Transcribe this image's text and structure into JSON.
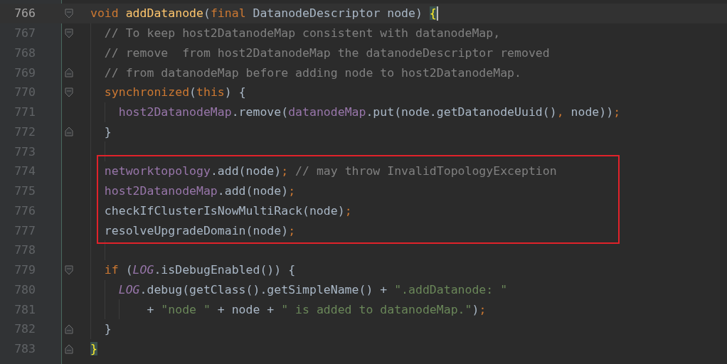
{
  "editor": {
    "lines": [
      {
        "number": "766",
        "current": true,
        "fold_open": true,
        "fold_close": false,
        "boxed": false,
        "caret": true,
        "tokens": [
          {
            "text": "void ",
            "kind": "kw"
          },
          {
            "text": "addDatanode",
            "kind": "fn"
          },
          {
            "text": "(",
            "kind": "plain"
          },
          {
            "text": "final ",
            "kind": "kw"
          },
          {
            "text": "DatanodeDescriptor node) ",
            "kind": "plain"
          },
          {
            "text": "{",
            "kind": "brace"
          }
        ],
        "children": [
          {
            "number": "767",
            "current": false,
            "fold_open": true,
            "fold_close": false,
            "boxed": false,
            "caret": false,
            "tokens": [
              {
                "text": "// To keep host2DatanodeMap consistent with datanodeMap,",
                "kind": "comment"
              }
            ]
          },
          {
            "number": "768",
            "current": false,
            "fold_open": false,
            "fold_close": false,
            "boxed": false,
            "caret": false,
            "tokens": [
              {
                "text": "// remove  from host2DatanodeMap the datanodeDescriptor removed",
                "kind": "comment"
              }
            ]
          },
          {
            "number": "769",
            "current": false,
            "fold_open": false,
            "fold_close": true,
            "boxed": false,
            "caret": false,
            "tokens": [
              {
                "text": "// from datanodeMap before adding node to host2DatanodeMap.",
                "kind": "comment"
              }
            ]
          },
          {
            "number": "770",
            "current": false,
            "fold_open": true,
            "fold_close": false,
            "boxed": false,
            "caret": false,
            "tokens": [
              {
                "text": "synchronized",
                "kind": "kw"
              },
              {
                "text": "(",
                "kind": "plain"
              },
              {
                "text": "this",
                "kind": "kw"
              },
              {
                "text": ") {",
                "kind": "plain"
              }
            ],
            "children": [
              {
                "number": "771",
                "current": false,
                "fold_open": false,
                "fold_close": false,
                "boxed": false,
                "caret": false,
                "tokens": [
                  {
                    "text": "host2DatanodeMap",
                    "kind": "field"
                  },
                  {
                    "text": ".remove(",
                    "kind": "plain"
                  },
                  {
                    "text": "datanodeMap",
                    "kind": "field"
                  },
                  {
                    "text": ".put(node.getDatanodeUuid()",
                    "kind": "plain"
                  },
                  {
                    "text": ", ",
                    "kind": "punct"
                  },
                  {
                    "text": "node))",
                    "kind": "plain"
                  },
                  {
                    "text": ";",
                    "kind": "punct"
                  }
                ]
              }
            ]
          },
          {
            "number": "772",
            "current": false,
            "fold_open": false,
            "fold_close": true,
            "boxed": false,
            "caret": false,
            "tokens": [
              {
                "text": "}",
                "kind": "plain"
              }
            ]
          },
          {
            "number": "773",
            "current": false,
            "fold_open": false,
            "fold_close": false,
            "boxed": false,
            "caret": false
          },
          {
            "number": "774",
            "current": false,
            "fold_open": false,
            "fold_close": false,
            "boxed": true,
            "caret": false,
            "tokens": [
              {
                "text": "networktopology",
                "kind": "field"
              },
              {
                "text": ".add(node)",
                "kind": "plain"
              },
              {
                "text": "; ",
                "kind": "punct"
              },
              {
                "text": "// may throw InvalidTopologyException",
                "kind": "comment"
              }
            ]
          },
          {
            "number": "775",
            "current": false,
            "fold_open": false,
            "fold_close": false,
            "boxed": true,
            "caret": false,
            "tokens": [
              {
                "text": "host2DatanodeMap",
                "kind": "field"
              },
              {
                "text": ".add(node)",
                "kind": "plain"
              },
              {
                "text": ";",
                "kind": "punct"
              }
            ]
          },
          {
            "number": "776",
            "current": false,
            "fold_open": false,
            "fold_close": false,
            "boxed": true,
            "caret": false,
            "tokens": [
              {
                "text": "checkIfClusterIsNowMultiRack(node)",
                "kind": "plain"
              },
              {
                "text": ";",
                "kind": "punct"
              }
            ]
          },
          {
            "number": "777",
            "current": false,
            "fold_open": false,
            "fold_close": false,
            "boxed": true,
            "caret": false,
            "tokens": [
              {
                "text": "resolveUpgradeDomain(node)",
                "kind": "plain"
              },
              {
                "text": ";",
                "kind": "punct"
              }
            ]
          },
          {
            "number": "778",
            "current": false,
            "fold_open": false,
            "fold_close": false,
            "boxed": false,
            "caret": false
          },
          {
            "number": "779",
            "current": false,
            "fold_open": true,
            "fold_close": false,
            "boxed": false,
            "caret": false,
            "tokens": [
              {
                "text": "if ",
                "kind": "kw"
              },
              {
                "text": "(",
                "kind": "plain"
              },
              {
                "text": "LOG",
                "kind": "static"
              },
              {
                "text": ".isDebugEnabled()) {",
                "kind": "plain"
              }
            ],
            "children": [
              {
                "number": "780",
                "current": false,
                "fold_open": false,
                "fold_close": false,
                "boxed": false,
                "caret": false,
                "tokens": [
                  {
                    "text": "LOG",
                    "kind": "static"
                  },
                  {
                    "text": ".debug(getClass().getSimpleName() + ",
                    "kind": "plain"
                  },
                  {
                    "text": "\".addDatanode: \"",
                    "kind": "string"
                  }
                ],
                "children": [
                  {
                    "number": "781",
                    "current": false,
                    "fold_open": false,
                    "fold_close": false,
                    "boxed": false,
                    "caret": false,
                    "tokens": [
                      {
                        "text": "  + ",
                        "kind": "plain"
                      },
                      {
                        "text": "\"node \"",
                        "kind": "string"
                      },
                      {
                        "text": " + node + ",
                        "kind": "plain"
                      },
                      {
                        "text": "\" is added to datanodeMap.\"",
                        "kind": "string"
                      },
                      {
                        "text": ")",
                        "kind": "plain"
                      },
                      {
                        "text": ";",
                        "kind": "punct"
                      }
                    ]
                  }
                ]
              }
            ]
          },
          {
            "number": "782",
            "current": false,
            "fold_open": false,
            "fold_close": true,
            "boxed": false,
            "caret": false,
            "tokens": [
              {
                "text": "}",
                "kind": "plain"
              }
            ]
          }
        ]
      },
      {
        "number": "783",
        "current": false,
        "fold_open": false,
        "fold_close": true,
        "boxed": false,
        "caret": false,
        "tokens": [
          {
            "text": "}",
            "kind": "brace"
          }
        ]
      }
    ]
  }
}
